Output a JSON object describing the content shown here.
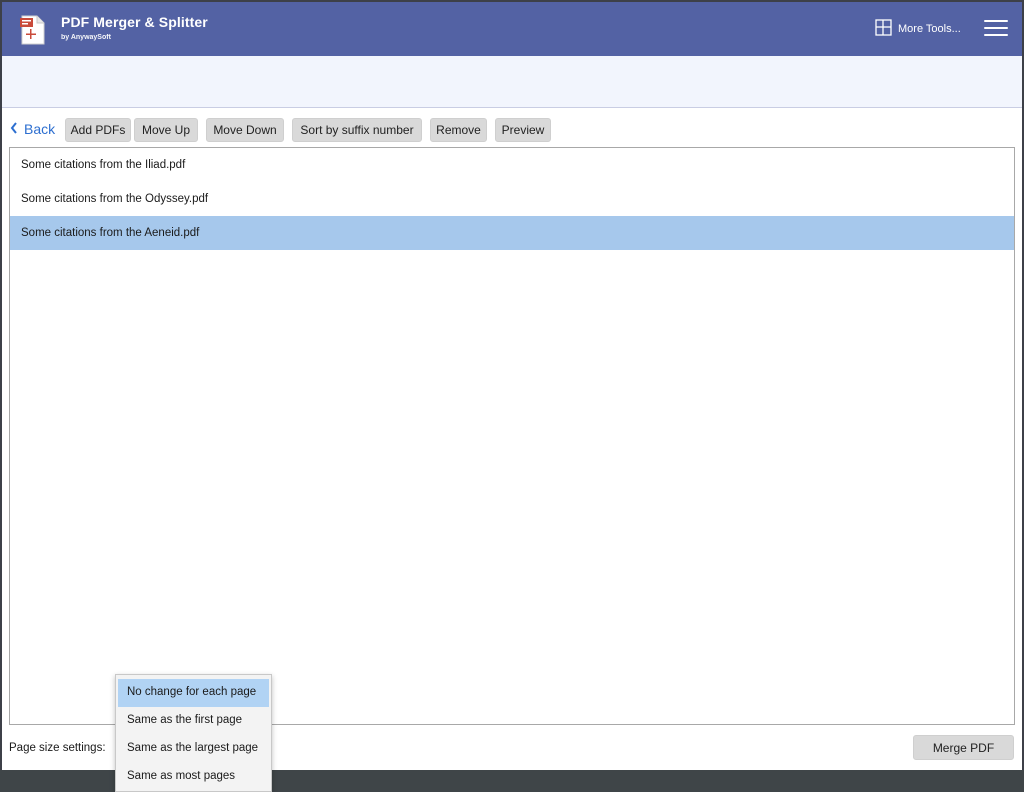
{
  "app": {
    "title": "PDF Merger & Splitter",
    "subtitle": "by AnywaySoft",
    "more_tools": "More Tools...",
    "accent_color": "#5362a4"
  },
  "toolbar": {
    "back_label": "Back",
    "buttons": [
      "Add PDFs",
      "Move Up",
      "Move Down",
      "Sort by suffix number",
      "Remove",
      "Preview"
    ]
  },
  "files": [
    {
      "name": "Some citations from the Iliad.pdf",
      "selected": false
    },
    {
      "name": "Some citations from the Odyssey.pdf",
      "selected": false
    },
    {
      "name": "Some citations from the Aeneid.pdf",
      "selected": true
    }
  ],
  "footer": {
    "page_size_label": "Page size settings:",
    "merge_label": "Merge PDF"
  },
  "page_size_dropdown": {
    "selected": "No change for each page",
    "options": [
      "No change for each page",
      "Same as the first page",
      "Same as the largest page",
      "Same as most pages"
    ]
  },
  "icons": {
    "app": "pdf-document-icon",
    "more_tools": "layout-panels-icon",
    "menu": "hamburger-menu-icon",
    "back": "chevron-left-icon"
  }
}
